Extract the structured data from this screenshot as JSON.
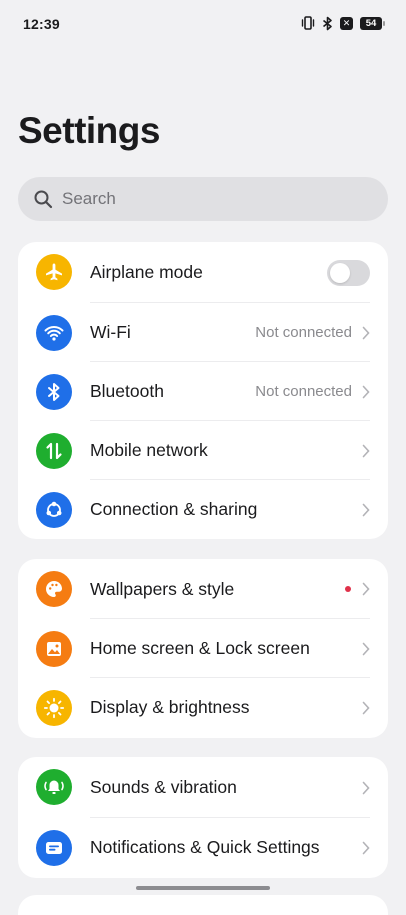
{
  "status_bar": {
    "time": "12:39",
    "battery": "54",
    "icons": [
      "vibrate-icon",
      "bluetooth-icon",
      "sim-off-icon",
      "battery-icon"
    ]
  },
  "page": {
    "title": "Settings"
  },
  "search": {
    "placeholder": "Search"
  },
  "groups": [
    {
      "items": [
        {
          "label": "Airplane mode",
          "icon": "airplane-icon",
          "color": "#f7b500",
          "control": "toggle",
          "toggle_on": false
        },
        {
          "label": "Wi-Fi",
          "icon": "wifi-icon",
          "color": "#1f6fe8",
          "value": "Not connected",
          "control": "chevron"
        },
        {
          "label": "Bluetooth",
          "icon": "bluetooth-icon",
          "color": "#1f6fe8",
          "value": "Not connected",
          "control": "chevron"
        },
        {
          "label": "Mobile network",
          "icon": "mobile-data-icon",
          "color": "#1fae2f",
          "control": "chevron"
        },
        {
          "label": "Connection & sharing",
          "icon": "share-icon",
          "color": "#1f6fe8",
          "control": "chevron"
        }
      ]
    },
    {
      "items": [
        {
          "label": "Wallpapers & style",
          "icon": "palette-icon",
          "color": "#f57c12",
          "control": "chevron",
          "badge": "red-dot"
        },
        {
          "label": "Home screen & Lock screen",
          "icon": "home-screen-icon",
          "color": "#f57c12",
          "control": "chevron"
        },
        {
          "label": "Display & brightness",
          "icon": "sun-icon",
          "color": "#f7b500",
          "control": "chevron"
        }
      ]
    },
    {
      "items": [
        {
          "label": "Sounds & vibration",
          "icon": "bell-icon",
          "color": "#1fae2f",
          "control": "chevron"
        },
        {
          "label": "Notifications & Quick Settings",
          "icon": "notification-icon",
          "color": "#1f6fe8",
          "control": "chevron"
        }
      ]
    }
  ]
}
